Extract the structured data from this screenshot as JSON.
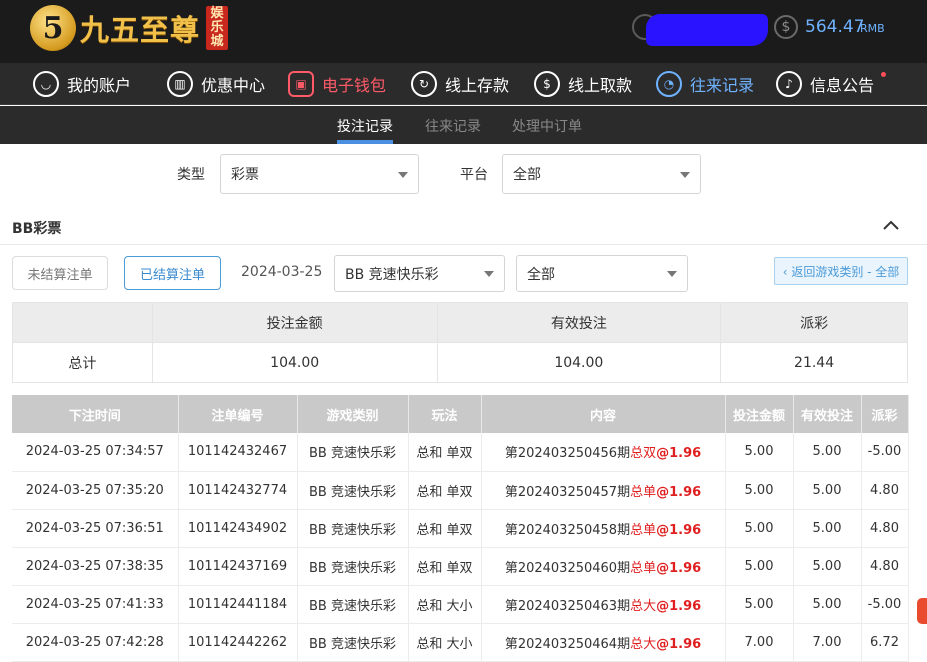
{
  "header": {
    "logo_digit": "5",
    "logo_text": "九五至尊",
    "logo_seal": [
      "娱",
      "乐",
      "城"
    ],
    "balance": "564.47",
    "currency": "RMB"
  },
  "nav": {
    "items": [
      {
        "label": "我的账户"
      },
      {
        "label": "优惠中心"
      },
      {
        "label": "电子钱包"
      },
      {
        "label": "线上存款"
      },
      {
        "label": "线上取款"
      },
      {
        "label": "往来记录"
      },
      {
        "label": "信息公告"
      }
    ]
  },
  "subnav": {
    "items": [
      {
        "label": "投注记录"
      },
      {
        "label": "往来记录"
      },
      {
        "label": "处理中订单"
      }
    ]
  },
  "filters": {
    "type_label": "类型",
    "type_value": "彩票",
    "platform_label": "平台",
    "platform_value": "全部"
  },
  "section": {
    "title": "BB彩票",
    "tab_unsettled": "未结算注单",
    "tab_settled": "已结算注单",
    "date": "2024-03-25",
    "game_select": "BB 竞速快乐彩",
    "option_select": "全部",
    "back_label": "‹ 返回游戏类别 - 全部"
  },
  "summary": {
    "headers": [
      "",
      "投注金额",
      "有效投注",
      "派彩"
    ],
    "row_label": "总计",
    "bet_amount": "104.00",
    "valid_bet": "104.00",
    "payout": "21.44"
  },
  "table": {
    "headers": [
      "下注时间",
      "注单编号",
      "游戏类别",
      "玩法",
      "内容",
      "投注金额",
      "有效投注",
      "派彩"
    ],
    "rows": [
      {
        "time": "2024-03-25 07:34:57",
        "id": "101142432467",
        "game": "BB 竞速快乐彩",
        "play": "总和 单双",
        "period": "第202403250456期",
        "pick": "总双",
        "odds": "@1.96",
        "bet": "5.00",
        "valid": "5.00",
        "payout": "-5.00"
      },
      {
        "time": "2024-03-25 07:35:20",
        "id": "101142432774",
        "game": "BB 竞速快乐彩",
        "play": "总和 单双",
        "period": "第202403250457期",
        "pick": "总单",
        "odds": "@1.96",
        "bet": "5.00",
        "valid": "5.00",
        "payout": "4.80"
      },
      {
        "time": "2024-03-25 07:36:51",
        "id": "101142434902",
        "game": "BB 竞速快乐彩",
        "play": "总和 单双",
        "period": "第202403250458期",
        "pick": "总单",
        "odds": "@1.96",
        "bet": "5.00",
        "valid": "5.00",
        "payout": "4.80"
      },
      {
        "time": "2024-03-25 07:38:35",
        "id": "101142437169",
        "game": "BB 竞速快乐彩",
        "play": "总和 单双",
        "period": "第202403250460期",
        "pick": "总单",
        "odds": "@1.96",
        "bet": "5.00",
        "valid": "5.00",
        "payout": "4.80"
      },
      {
        "time": "2024-03-25 07:41:33",
        "id": "101142441184",
        "game": "BB 竞速快乐彩",
        "play": "总和 大小",
        "period": "第202403250463期",
        "pick": "总大",
        "odds": "@1.96",
        "bet": "5.00",
        "valid": "5.00",
        "payout": "-5.00"
      },
      {
        "time": "2024-03-25 07:42:28",
        "id": "101142442262",
        "game": "BB 竞速快乐彩",
        "play": "总和 大小",
        "period": "第202403250464期",
        "pick": "总大",
        "odds": "@1.96",
        "bet": "7.00",
        "valid": "7.00",
        "payout": "6.72"
      }
    ]
  },
  "colors": {
    "accent_blue": "#6fb2ff",
    "accent_red": "#ff5a68",
    "negative": "#e02020",
    "header_bg": "#1b1b1b",
    "nav_bg": "#2b2b2b"
  }
}
